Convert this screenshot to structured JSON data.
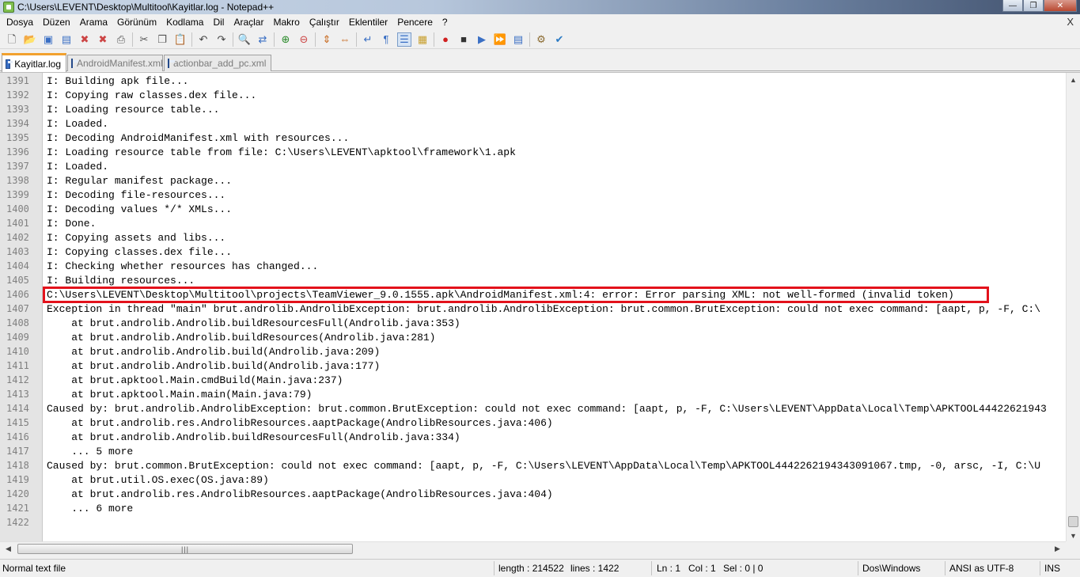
{
  "window": {
    "title": "C:\\Users\\LEVENT\\Desktop\\Multitool\\Kayitlar.log - Notepad++",
    "minimize_glyph": "—",
    "restore_glyph": "❐",
    "close_glyph": "✕"
  },
  "menu": {
    "items": [
      "Dosya",
      "Düzen",
      "Arama",
      "Görünüm",
      "Kodlama",
      "Dil",
      "Araçlar",
      "Makro",
      "Çalıştır",
      "Eklentiler",
      "Pencere",
      "?"
    ],
    "close_glyph": "X"
  },
  "toolbar": {
    "icons": [
      {
        "name": "new-file-icon",
        "glyph": "🗋",
        "color": "#444"
      },
      {
        "name": "open-file-icon",
        "glyph": "📂",
        "color": "#c8a030"
      },
      {
        "name": "save-icon",
        "glyph": "▣",
        "color": "#3a6fc4"
      },
      {
        "name": "save-all-icon",
        "glyph": "▤",
        "color": "#3a6fc4"
      },
      {
        "name": "close-file-icon",
        "glyph": "✖",
        "color": "#c44"
      },
      {
        "name": "close-all-icon",
        "glyph": "✖",
        "color": "#c44"
      },
      {
        "name": "print-icon",
        "glyph": "⎙",
        "color": "#555"
      },
      {
        "name": "cut-icon",
        "glyph": "✂",
        "color": "#555"
      },
      {
        "name": "copy-icon",
        "glyph": "❐",
        "color": "#555"
      },
      {
        "name": "paste-icon",
        "glyph": "📋",
        "color": "#8a6a30"
      },
      {
        "name": "undo-icon",
        "glyph": "↶",
        "color": "#444"
      },
      {
        "name": "redo-icon",
        "glyph": "↷",
        "color": "#444"
      },
      {
        "name": "find-icon",
        "glyph": "🔍",
        "color": "#333"
      },
      {
        "name": "replace-icon",
        "glyph": "⇄",
        "color": "#3a6fc4"
      },
      {
        "name": "zoom-in-icon",
        "glyph": "⊕",
        "color": "#2a8a2a"
      },
      {
        "name": "zoom-out-icon",
        "glyph": "⊖",
        "color": "#c44"
      },
      {
        "name": "sync-vertical-icon",
        "glyph": "⇕",
        "color": "#c86a20"
      },
      {
        "name": "sync-horizontal-icon",
        "glyph": "⇔",
        "color": "#c86a20"
      },
      {
        "name": "word-wrap-icon",
        "glyph": "↵",
        "color": "#3a6fc4"
      },
      {
        "name": "show-all-characters-icon",
        "glyph": "¶",
        "color": "#3a6fc4"
      },
      {
        "name": "indent-guide-icon",
        "glyph": "☰",
        "color": "#3a6fc4"
      },
      {
        "name": "language-udl-icon",
        "glyph": "▦",
        "color": "#c8a030"
      },
      {
        "name": "macro-record-icon",
        "glyph": "●",
        "color": "#d02020"
      },
      {
        "name": "macro-stop-icon",
        "glyph": "■",
        "color": "#333"
      },
      {
        "name": "macro-play-icon",
        "glyph": "▶",
        "color": "#3a6fc4"
      },
      {
        "name": "macro-play-multiple-icon",
        "glyph": "⏩",
        "color": "#3a6fc4"
      },
      {
        "name": "macro-save-icon",
        "glyph": "▤",
        "color": "#3a6fc4"
      },
      {
        "name": "run-icon",
        "glyph": "⚙",
        "color": "#8a6a30"
      },
      {
        "name": "spell-check-icon",
        "glyph": "✔",
        "color": "#2a7ac4"
      }
    ]
  },
  "tabs": [
    {
      "label": "Kayitlar.log",
      "active": true
    },
    {
      "label": "AndroidManifest.xml",
      "active": false
    },
    {
      "label": "actionbar_add_pc.xml",
      "active": false
    }
  ],
  "editor": {
    "lines": [
      {
        "num": "1391",
        "text": "I: Building apk file..."
      },
      {
        "num": "1392",
        "text": "I: Copying raw classes.dex file..."
      },
      {
        "num": "1393",
        "text": "I: Loading resource table..."
      },
      {
        "num": "1394",
        "text": "I: Loaded."
      },
      {
        "num": "1395",
        "text": "I: Decoding AndroidManifest.xml with resources..."
      },
      {
        "num": "1396",
        "text": "I: Loading resource table from file: C:\\Users\\LEVENT\\apktool\\framework\\1.apk"
      },
      {
        "num": "1397",
        "text": "I: Loaded."
      },
      {
        "num": "1398",
        "text": "I: Regular manifest package..."
      },
      {
        "num": "1399",
        "text": "I: Decoding file-resources..."
      },
      {
        "num": "1400",
        "text": "I: Decoding values */* XMLs..."
      },
      {
        "num": "1401",
        "text": "I: Done."
      },
      {
        "num": "1402",
        "text": "I: Copying assets and libs..."
      },
      {
        "num": "1403",
        "text": "I: Copying classes.dex file..."
      },
      {
        "num": "1404",
        "text": "I: Checking whether resources has changed..."
      },
      {
        "num": "1405",
        "text": "I: Building resources..."
      },
      {
        "num": "1406",
        "text": "C:\\Users\\LEVENT\\Desktop\\Multitool\\projects\\TeamViewer_9.0.1555.apk\\AndroidManifest.xml:4: error: Error parsing XML: not well-formed (invalid token)"
      },
      {
        "num": "1407",
        "text": "Exception in thread \"main\" brut.androlib.AndrolibException: brut.androlib.AndrolibException: brut.common.BrutException: could not exec command: [aapt, p, -F, C:\\"
      },
      {
        "num": "1408",
        "text": "    at brut.androlib.Androlib.buildResourcesFull(Androlib.java:353)"
      },
      {
        "num": "1409",
        "text": "    at brut.androlib.Androlib.buildResources(Androlib.java:281)"
      },
      {
        "num": "1410",
        "text": "    at brut.androlib.Androlib.build(Androlib.java:209)"
      },
      {
        "num": "1411",
        "text": "    at brut.androlib.Androlib.build(Androlib.java:177)"
      },
      {
        "num": "1412",
        "text": "    at brut.apktool.Main.cmdBuild(Main.java:237)"
      },
      {
        "num": "1413",
        "text": "    at brut.apktool.Main.main(Main.java:79)"
      },
      {
        "num": "1414",
        "text": "Caused by: brut.androlib.AndrolibException: brut.common.BrutException: could not exec command: [aapt, p, -F, C:\\Users\\LEVENT\\AppData\\Local\\Temp\\APKTOOL44422621943"
      },
      {
        "num": "1415",
        "text": "    at brut.androlib.res.AndrolibResources.aaptPackage(AndrolibResources.java:406)"
      },
      {
        "num": "1416",
        "text": "    at brut.androlib.Androlib.buildResourcesFull(Androlib.java:334)"
      },
      {
        "num": "1417",
        "text": "    ... 5 more"
      },
      {
        "num": "1418",
        "text": "Caused by: brut.common.BrutException: could not exec command: [aapt, p, -F, C:\\Users\\LEVENT\\AppData\\Local\\Temp\\APKTOOL4442262194343091067.tmp, -0, arsc, -I, C:\\U"
      },
      {
        "num": "1419",
        "text": "    at brut.util.OS.exec(OS.java:89)"
      },
      {
        "num": "1420",
        "text": "    at brut.androlib.res.AndrolibResources.aaptPackage(AndrolibResources.java:404)"
      },
      {
        "num": "1421",
        "text": "    ... 6 more"
      },
      {
        "num": "1422",
        "text": ""
      }
    ],
    "highlighted_line": "1406",
    "highlight_color": "#e3121b"
  },
  "scrollbars": {
    "up_arrow": "▲",
    "down_arrow": "▼",
    "left_arrow": "◀",
    "right_arrow": "▶",
    "hthumb_grip": "|||"
  },
  "statusbar": {
    "file_type": "Normal text file",
    "length": "length : 214522",
    "lines": "lines : 1422",
    "ln": "Ln : 1",
    "col": "Col : 1",
    "sel": "Sel : 0 | 0",
    "eol": "Dos\\Windows",
    "encoding": "ANSI as UTF-8",
    "mode": "INS"
  }
}
